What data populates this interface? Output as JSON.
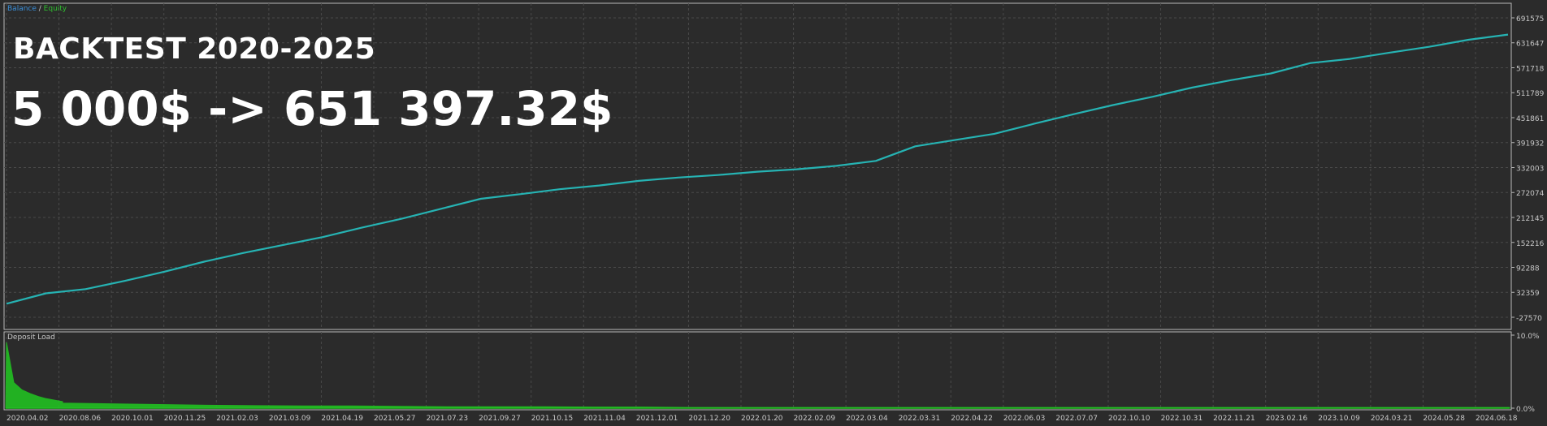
{
  "legend": {
    "balance": "Balance",
    "separator": " / ",
    "equity": "Equity"
  },
  "overlay": {
    "title": "BACKTEST 2020-2025",
    "result": "5 000$ -> 651 397.32$"
  },
  "colors": {
    "background": "#2b2b2b",
    "frame": "#b8b8b8",
    "grid": "#4a4a4a",
    "balance": "#3a8fd9",
    "equity": "#26b3b3",
    "deposit_load": "#22c022",
    "text": "#c8c8c8"
  },
  "deposit_panel": {
    "label": "Deposit Load",
    "y_ticks": [
      "10.0%",
      "0.0%"
    ]
  },
  "chart_data": [
    {
      "type": "line",
      "title": "",
      "series": [
        {
          "name": "Equity",
          "values": [
            5000,
            30000,
            40000,
            60000,
            82000,
            106000,
            127000,
            146000,
            165000,
            188000,
            209000,
            233000,
            257000,
            268000,
            280000,
            289000,
            300000,
            308000,
            314000,
            322000,
            328000,
            336000,
            348000,
            383000,
            398000,
            413000,
            437000,
            460000,
            482000,
            502000,
            524000,
            542000,
            558000,
            583000,
            593000,
            608000,
            622000,
            639000,
            651397
          ]
        }
      ],
      "y_ticks": [
        "691575",
        "631647",
        "571718",
        "511789",
        "451861",
        "391932",
        "332003",
        "272074",
        "212145",
        "152216",
        "92288",
        "32359",
        "-27570"
      ],
      "ylim": [
        -27570,
        691575
      ],
      "x_ticks": [
        "2020.04.02",
        "2020.08.06",
        "2020.10.01",
        "2020.11.25",
        "2021.02.03",
        "2021.03.09",
        "2021.04.19",
        "2021.05.27",
        "2021.07.23",
        "2021.09.27",
        "2021.10.15",
        "2021.11.04",
        "2021.12.01",
        "2021.12.20",
        "2022.01.20",
        "2022.02.09",
        "2022.03.04",
        "2022.03.31",
        "2022.04.22",
        "2022.06.03",
        "2022.07.07",
        "2022.10.10",
        "2022.10.31",
        "2022.11.21",
        "2023.02.16",
        "2023.10.09",
        "2024.03.21",
        "2024.05.28",
        "2024.06.18"
      ],
      "grid": true
    },
    {
      "type": "area",
      "title": "Deposit Load",
      "series": [
        {
          "name": "Deposit Load",
          "values": [
            9.0,
            3.5,
            2.5,
            2.0,
            1.6,
            1.3,
            1.1,
            0.9,
            0.7,
            0.6,
            0.5,
            0.4,
            0.35,
            0.3,
            0.3,
            0.25,
            0.2,
            0.2,
            0.2,
            0.15,
            0.15,
            0.1,
            0.1,
            0.1,
            0.1,
            0.1,
            0.1,
            0.1,
            0.1,
            0.1,
            0.1,
            0.1,
            0.1,
            0.1,
            0.1,
            0.1,
            0.1,
            0.1,
            0.1
          ]
        }
      ],
      "ylim": [
        0,
        10
      ],
      "y_ticks": [
        "10.0%",
        "0.0%"
      ]
    }
  ]
}
